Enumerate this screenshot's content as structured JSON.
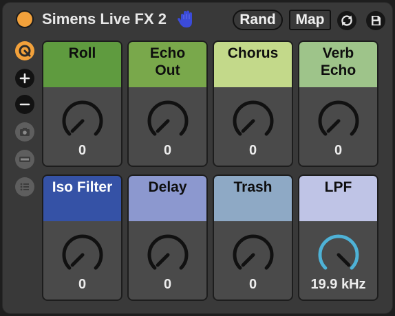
{
  "device": {
    "title": "Simens Live FX 2",
    "rand_label": "Rand",
    "map_label": "Map",
    "power_color": "#f2a13b",
    "accent_color": "#4fb2d6"
  },
  "side_icons": [
    "hotswap-icon",
    "plus-icon",
    "minus-icon",
    "camera-icon",
    "minus-box-icon",
    "list-icon"
  ],
  "pads": [
    {
      "label": "Roll",
      "value": "0",
      "color": "#5f9b3f",
      "dark": false,
      "knob_level": 0.0
    },
    {
      "label": "Echo\nOut",
      "value": "0",
      "color": "#79a84b",
      "dark": false,
      "knob_level": 0.0
    },
    {
      "label": "Chorus",
      "value": "0",
      "color": "#c3d98a",
      "dark": false,
      "knob_level": 0.0
    },
    {
      "label": "Verb\nEcho",
      "value": "0",
      "color": "#9ec48a",
      "dark": false,
      "knob_level": 0.0
    },
    {
      "label": "Iso Filter",
      "value": "0",
      "color": "#3552a6",
      "dark": true,
      "knob_level": 0.0
    },
    {
      "label": "Delay",
      "value": "0",
      "color": "#8c98cf",
      "dark": false,
      "knob_level": 0.0
    },
    {
      "label": "Trash",
      "value": "0",
      "color": "#8ea9c5",
      "dark": false,
      "knob_level": 0.0
    },
    {
      "label": "LPF",
      "value": "19.9 kHz",
      "color": "#bfc4e6",
      "dark": false,
      "knob_level": 1.0
    }
  ]
}
